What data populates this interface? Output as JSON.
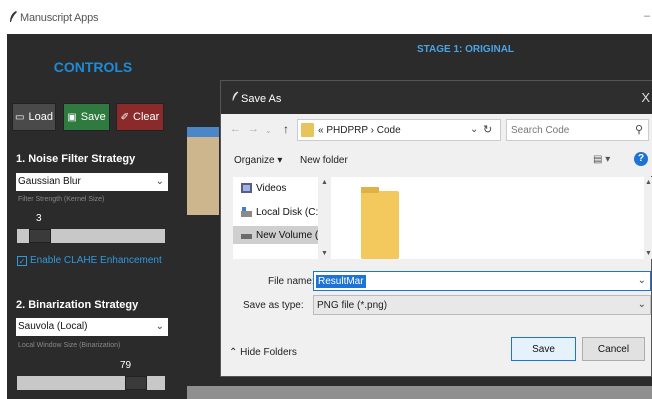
{
  "app": {
    "title": "Manuscript Apps",
    "minimize_glyph": "–"
  },
  "controls": {
    "title": "CONTROLS",
    "buttons": {
      "load": "Load",
      "save": "Save",
      "clear": "Clear"
    },
    "noise": {
      "heading": "1. Noise Filter Strategy",
      "selected": "Gaussian Blur",
      "hint": "Filter Strength (Kernel Size)",
      "value": "3",
      "level_fraction": 0.1
    },
    "clahe": {
      "label": "Enable CLAHE Enhancement",
      "checked": true
    },
    "binarization": {
      "heading": "2. Binarization Strategy",
      "selected": "Sauvola (Local)",
      "hint": "Local Window Size (Binarization)",
      "value": "79",
      "level_fraction": 0.8
    }
  },
  "stage": {
    "title": "STAGE 1: ORIGINAL"
  },
  "dialog": {
    "title": "Save As",
    "close_glyph": "X",
    "address": {
      "prefix": "«",
      "parts": [
        "PHDPRP",
        "Code"
      ],
      "separator": "›"
    },
    "search_placeholder": "Search Code",
    "toolbar": {
      "organize": "Organize ▾",
      "new_folder": "New folder",
      "help": "?"
    },
    "nav_tree": [
      {
        "label": "Videos",
        "icon": "videos-icon"
      },
      {
        "label": "Local Disk (C:)",
        "icon": "disk-icon"
      },
      {
        "label": "New Volume (D:",
        "icon": "drive-icon",
        "selected": true
      }
    ],
    "file_name_label": "File name:",
    "file_name_value": "ResultMar",
    "save_type_label": "Save as type:",
    "save_type_value": "PNG file (*.png)",
    "hide_folders": "Hide Folders",
    "save_button": "Save",
    "cancel_button": "Cancel"
  },
  "colors": {
    "accent_blue": "#1f8bd6",
    "save_green": "#2e7a3f",
    "clear_red": "#8a2a2a",
    "panel_dark": "#2b2b2b",
    "dialog_bg": "#f0f0f0"
  }
}
